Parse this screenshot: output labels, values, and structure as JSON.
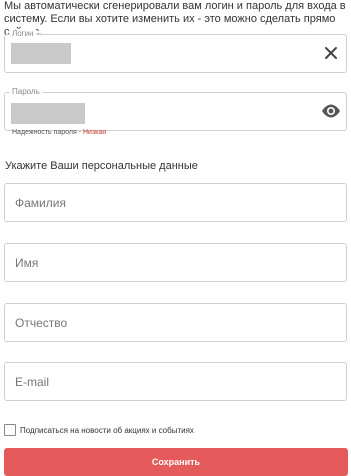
{
  "intro": {
    "text": "Мы автоматически сгенерировали вам логин и пароль для входа в систему. Если вы хотите изменить их - это можно сделать прямо сейчас."
  },
  "login": {
    "legend": "Логин"
  },
  "password": {
    "legend": "Пароль",
    "strength_label": "Надежность пароля - ",
    "strength_value": "Низкая"
  },
  "personal": {
    "title": "Укажите Ваши персональные данные",
    "lastname_placeholder": "Фамилия",
    "firstname_placeholder": "Имя",
    "patronymic_placeholder": "Отчество",
    "email_placeholder": "E-mail"
  },
  "subscribe": {
    "label": "Подписаться на новости об акциях и событиях"
  },
  "save_button": {
    "label": "Сохранить"
  },
  "colors": {
    "accent": "#e55a5a",
    "strength_low": "#c0392b",
    "border": "#cfcfcf"
  },
  "icons": {
    "clear": "close-icon",
    "reveal": "eye-icon"
  }
}
